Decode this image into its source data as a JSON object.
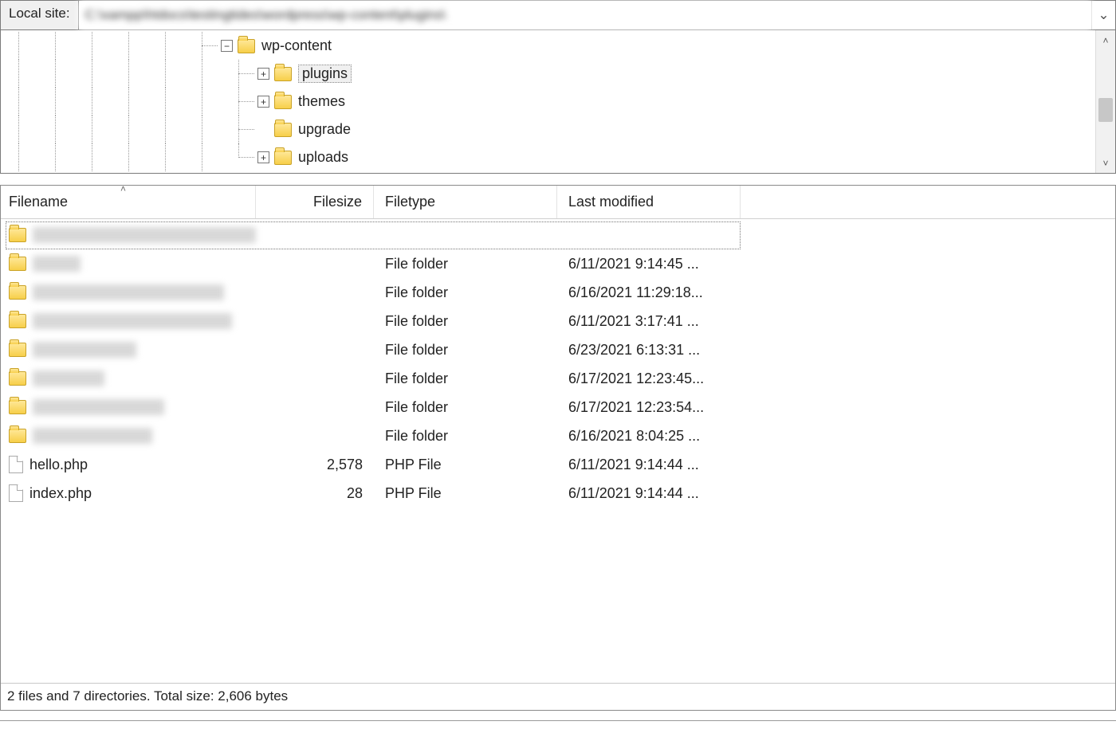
{
  "address": {
    "label": "Local site:",
    "path": "C:\\xampp\\htdocs\\testingtides\\wordpress\\wp-content\\plugins\\"
  },
  "tree": {
    "root": {
      "label": "wp-content",
      "expander": "−"
    },
    "children": [
      {
        "label": "plugins",
        "expander": "+",
        "selected": true
      },
      {
        "label": "themes",
        "expander": "+"
      },
      {
        "label": "upgrade",
        "expander": ""
      },
      {
        "label": "uploads",
        "expander": "+"
      }
    ]
  },
  "columns": {
    "name": "Filename",
    "size": "Filesize",
    "type": "Filetype",
    "modified": "Last modified"
  },
  "rows": [
    {
      "icon": "folder",
      "name": "..",
      "size": "",
      "type": "",
      "modified": "",
      "blur": true,
      "focus": true
    },
    {
      "icon": "folder",
      "name": "a",
      "size": "",
      "type": "File folder",
      "modified": "6/11/2021 9:14:45 ...",
      "blur": true,
      "blurWidth": 60
    },
    {
      "icon": "folder",
      "name": "b",
      "size": "",
      "type": "File folder",
      "modified": "6/16/2021 11:29:18...",
      "blur": true,
      "blurWidth": 240
    },
    {
      "icon": "folder",
      "name": "b",
      "size": "",
      "type": "File folder",
      "modified": "6/11/2021 3:17:41 ...",
      "blur": true,
      "blurWidth": 250
    },
    {
      "icon": "folder",
      "name": "c",
      "size": "",
      "type": "File folder",
      "modified": "6/23/2021 6:13:31 ...",
      "blur": true,
      "blurWidth": 130
    },
    {
      "icon": "folder",
      "name": "f",
      "size": "",
      "type": "File folder",
      "modified": "6/17/2021 12:23:45...",
      "blur": true,
      "blurWidth": 90
    },
    {
      "icon": "folder",
      "name": "f",
      "size": "",
      "type": "File folder",
      "modified": "6/17/2021 12:23:54...",
      "blur": true,
      "blurWidth": 165
    },
    {
      "icon": "folder",
      "name": "v",
      "size": "",
      "type": "File folder",
      "modified": "6/16/2021 8:04:25 ...",
      "blur": true,
      "blurWidth": 150
    },
    {
      "icon": "file",
      "name": "hello.php",
      "size": "2,578",
      "type": "PHP File",
      "modified": "6/11/2021 9:14:44 ...",
      "blur": false
    },
    {
      "icon": "file",
      "name": "index.php",
      "size": "28",
      "type": "PHP File",
      "modified": "6/11/2021 9:14:44 ...",
      "blur": false
    }
  ],
  "status": "2 files and 7 directories. Total size: 2,606 bytes"
}
